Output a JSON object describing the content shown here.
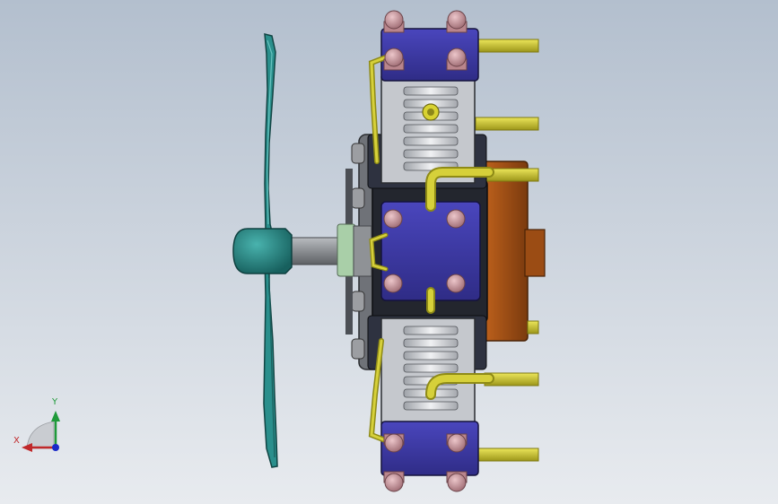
{
  "viewport": {
    "background_top": "#b5c1d0",
    "background_bottom": "#e6e9ee",
    "model_colors": {
      "propeller": "#2a8f8c",
      "propeller_dark": "#1c6e6c",
      "shaft": "#8d9094",
      "crankcase": "#262a34",
      "cylinder_head": "#3e3aa8",
      "bolt": "#c8959c",
      "fins": "#d0d2d6",
      "pipe": "#d2cc2a",
      "flywheel": "#9a4a12"
    }
  },
  "triad": {
    "x_label": "X",
    "y_label": "Y",
    "x_color": "#c0282a",
    "y_color": "#1f9a3a",
    "z_color": "#1a2ac8"
  }
}
